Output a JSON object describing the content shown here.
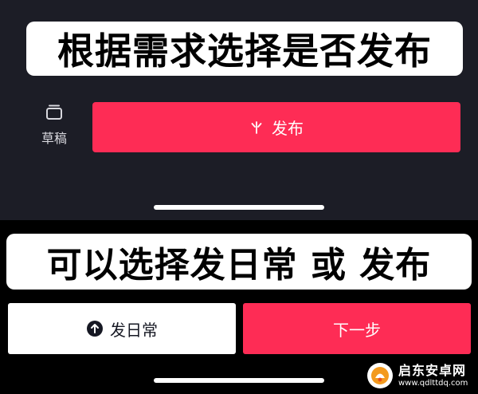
{
  "captions": {
    "top": "根据需求选择是否发布",
    "bottom": "可以选择发日常 或 发布"
  },
  "top_screen": {
    "draft_label": "草稿",
    "draft_icon": "draft-box-icon",
    "publish_label": "发布",
    "publish_icon": "sparkle-icon"
  },
  "bottom_screen": {
    "daily_label": "发日常",
    "daily_icon": "arrow-up-circle-icon",
    "next_label": "下一步"
  },
  "watermark": {
    "name": "启东安卓网",
    "url": "www.qdlttdq.com"
  },
  "colors": {
    "accent": "#fe2c55",
    "dark_bg": "#1c1d26",
    "black_bg": "#000000",
    "white": "#ffffff"
  }
}
